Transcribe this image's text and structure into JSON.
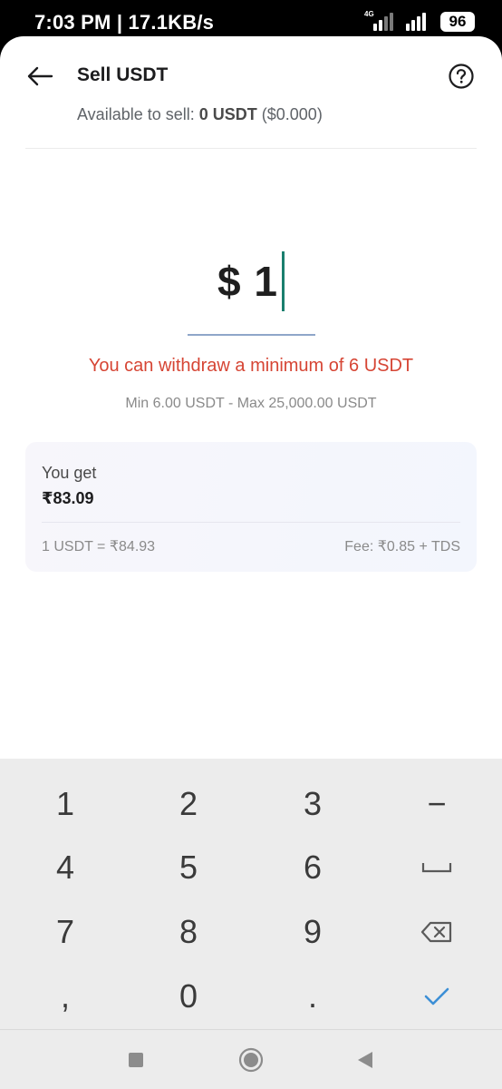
{
  "status_bar": {
    "time_speed": "7:03 PM | 17.1KB/s",
    "network": "4G",
    "battery": "96"
  },
  "header": {
    "title": "Sell USDT",
    "back_icon": "arrow-left-icon",
    "help_icon": "question-circle-icon"
  },
  "available": {
    "label": "Available to sell: ",
    "amount": "0 USDT",
    "open_paren": " (",
    "fiat": "$0.000",
    "close_paren": ")"
  },
  "amount_input": {
    "value": "$ 1"
  },
  "validation": {
    "error": "You can withdraw a minimum of 6 USDT",
    "limits": "Min 6.00 USDT - Max 25,000.00 USDT"
  },
  "receive_card": {
    "label": "You get",
    "value": "₹83.09",
    "rate": "1 USDT = ₹84.93",
    "fee": "Fee: ₹0.85 + TDS"
  },
  "keypad": {
    "keys": [
      "1",
      "2",
      "3",
      "−",
      "4",
      "5",
      "6",
      "",
      "7",
      "8",
      "9",
      "",
      ",",
      "0",
      ".",
      ""
    ],
    "icons": {
      "space": "space-bar-icon",
      "backspace": "backspace-icon",
      "done": "checkmark-icon"
    }
  },
  "nav_bar": {
    "icons": [
      "recents-square-icon",
      "home-circle-icon",
      "back-triangle-icon"
    ]
  },
  "colors": {
    "error": "#d64534",
    "cursor": "#1a7f6e",
    "done": "#3c8fd6"
  }
}
